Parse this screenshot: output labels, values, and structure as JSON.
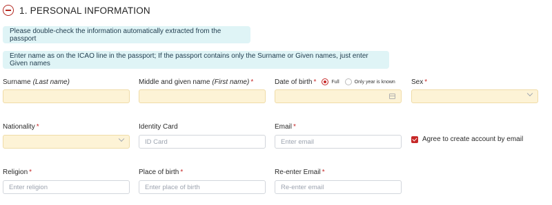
{
  "section": {
    "title": "1. PERSONAL INFORMATION"
  },
  "notices": {
    "double_check": "Please double-check the information automatically extracted from the passport",
    "icao": "Enter name as on the ICAO line in the passport; If the passport contains only the Surname or Given names, just enter Given names"
  },
  "fields": {
    "surname": {
      "label": "Surname",
      "hint": "(Last name)",
      "value": ""
    },
    "middle_given": {
      "label": "Middle and given name",
      "hint": "(First name)",
      "required": "*",
      "value": ""
    },
    "dob": {
      "label": "Date of birth",
      "required": "*",
      "option_full": "Full",
      "option_year": "Only year is known",
      "value": ""
    },
    "sex": {
      "label": "Sex",
      "required": "*",
      "value": ""
    },
    "nationality": {
      "label": "Nationality",
      "required": "*",
      "value": ""
    },
    "id_card": {
      "label": "Identity Card",
      "placeholder": "ID Card"
    },
    "email": {
      "label": "Email",
      "required": "*",
      "placeholder": "Enter email"
    },
    "religion": {
      "label": "Religion",
      "required": "*",
      "placeholder": "Enter religion"
    },
    "place_of_birth": {
      "label": "Place of birth",
      "required": "*",
      "placeholder": "Enter place of birth"
    },
    "reenter_email": {
      "label": "Re-enter Email",
      "required": "*",
      "placeholder": "Re-enter email"
    }
  },
  "agree_checkbox": {
    "label": "Agree to create account by email",
    "checked": true
  },
  "colors": {
    "accent": "#c62828",
    "notice_bg": "#dff4f6",
    "autofill_bg": "#fdf3d6"
  }
}
